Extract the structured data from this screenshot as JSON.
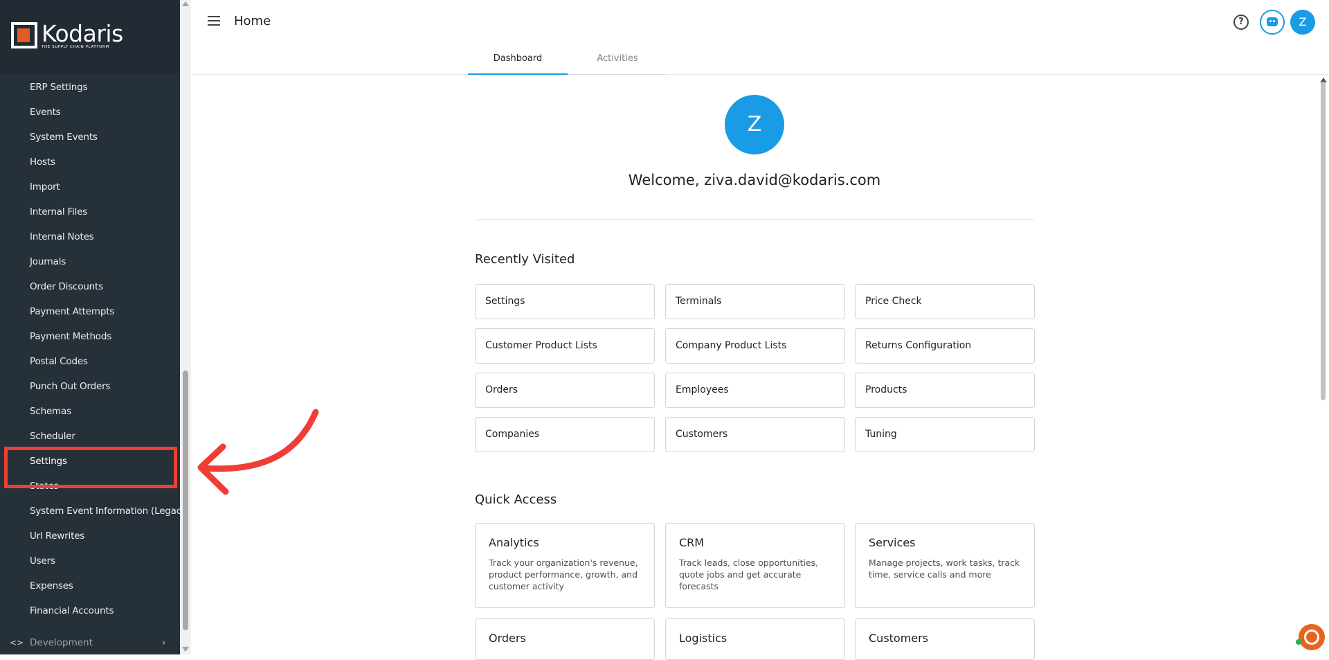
{
  "app": {
    "logo_name": "Kodaris",
    "logo_tagline": "THE SUPPLY CHAIN PLATFORM"
  },
  "sidebar": {
    "items": [
      {
        "label": "ERP Settings"
      },
      {
        "label": "Events"
      },
      {
        "label": "System Events"
      },
      {
        "label": "Hosts"
      },
      {
        "label": "Import"
      },
      {
        "label": "Internal Files"
      },
      {
        "label": "Internal Notes"
      },
      {
        "label": "Journals"
      },
      {
        "label": "Order Discounts"
      },
      {
        "label": "Payment Attempts"
      },
      {
        "label": "Payment Methods"
      },
      {
        "label": "Postal Codes"
      },
      {
        "label": "Punch Out Orders"
      },
      {
        "label": "Schemas"
      },
      {
        "label": "Scheduler"
      },
      {
        "label": "Settings"
      },
      {
        "label": "States"
      },
      {
        "label": "System Event Information (Legacy)"
      },
      {
        "label": "Url Rewrites"
      },
      {
        "label": "Users"
      },
      {
        "label": "Expenses"
      },
      {
        "label": "Financial Accounts"
      }
    ],
    "development": {
      "code_icon": "<>",
      "label": "Development",
      "chevron": "›"
    }
  },
  "header": {
    "title": "Home",
    "help_icon": "?",
    "avatar_initial": "Z"
  },
  "tabs": [
    {
      "label": "Dashboard",
      "active": true
    },
    {
      "label": "Activities",
      "active": false
    }
  ],
  "welcome": {
    "avatar_initial": "Z",
    "text": "Welcome, ziva.david@kodaris.com"
  },
  "recently_visited": {
    "title": "Recently Visited",
    "items": [
      "Settings",
      "Terminals",
      "Price Check",
      "Customer Product Lists",
      "Company Product Lists",
      "Returns Configuration",
      "Orders",
      "Employees",
      "Products",
      "Companies",
      "Customers",
      "Tuning"
    ]
  },
  "quick_access": {
    "title": "Quick Access",
    "items": [
      {
        "title": "Analytics",
        "desc": "Track your organization's revenue, product performance, growth, and customer activity"
      },
      {
        "title": "CRM",
        "desc": "Track leads, close opportunities, quote jobs and get accurate forecasts"
      },
      {
        "title": "Services",
        "desc": "Manage projects, work tasks, track time, service calls and more"
      },
      {
        "title": "Orders",
        "desc": ""
      },
      {
        "title": "Logistics",
        "desc": ""
      },
      {
        "title": "Customers",
        "desc": ""
      }
    ]
  },
  "colors": {
    "sidebar_bg": "#263039",
    "accent": "#1a9be6",
    "highlight": "#ef3e36",
    "brand_orange": "#e25b26"
  }
}
